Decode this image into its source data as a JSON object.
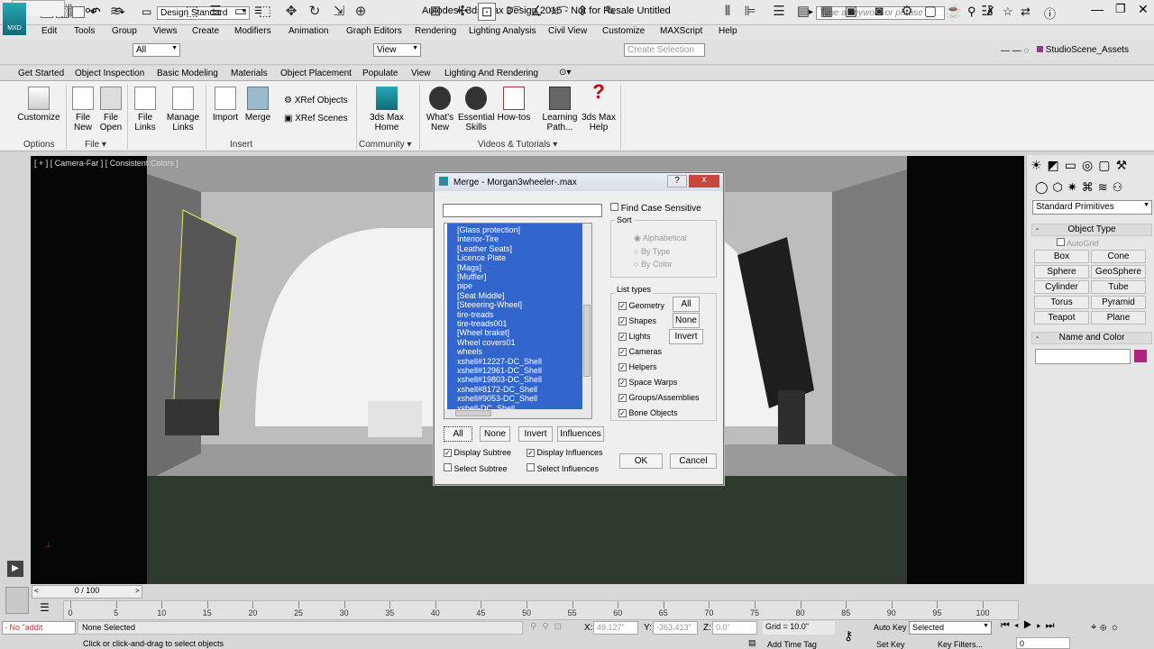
{
  "app": {
    "title": "Autodesk 3ds Max Design 2015  -  Not for Resale    Untitled",
    "logo_text": "MXD",
    "workspace": "Design Standard",
    "search_placeholder": "Type a keyword or phrase"
  },
  "menu": [
    "Edit",
    "Tools",
    "Group",
    "Views",
    "Create",
    "Modifiers",
    "Animation",
    "Graph Editors",
    "Rendering",
    "Lighting Analysis",
    "Civil View",
    "Customize",
    "MAXScript",
    "Help"
  ],
  "toolbar": {
    "filter": "All",
    "view": "View",
    "selection_set": "Create Selection Se",
    "scene": "StudioScene_Assets",
    "snap_labels": [
      "3",
      "%"
    ]
  },
  "ribbon_tabs": [
    "Get Started",
    "Object Inspection",
    "Basic Modeling",
    "Materials",
    "Object Placement",
    "Populate",
    "View",
    "Lighting And Rendering"
  ],
  "ribbon": {
    "customize": "Customize",
    "file_new": [
      "File",
      "New"
    ],
    "file_open": [
      "File",
      "Open"
    ],
    "file_links": [
      "File",
      "Links"
    ],
    "manage_links": [
      "Manage",
      "Links"
    ],
    "import": "Import",
    "merge": "Merge",
    "xref_objects": "XRef Objects",
    "xref_scenes": "XRef Scenes",
    "home": [
      "3ds Max",
      "Home"
    ],
    "whats_new": [
      "What's",
      "New"
    ],
    "essential": [
      "Essential",
      "Skills"
    ],
    "howtos": "How-tos",
    "learning": [
      "Learning",
      "Path..."
    ],
    "help": [
      "3ds Max",
      "Help"
    ],
    "groups": {
      "options": "Options",
      "file": "File",
      "insert": "Insert",
      "community": "Community",
      "videos": "Videos & Tutorials"
    }
  },
  "viewport": {
    "label": "[ + ] [ Camera-Far ] [ Consistent Colors ]"
  },
  "dialog": {
    "title": "Merge - Morgan3wheeler-.max",
    "help": "?",
    "close": "x",
    "items": [
      "[Glass protection]",
      "Interior-Tire",
      "[Leather Seats]",
      "Licence Plate",
      "[Mags]",
      "[Muffler]",
      "pipe",
      "[Seat Middle]",
      "[Steeering-Wheel]",
      "tire-treads",
      "tire-treads001",
      "[Wheel braket]",
      "Wheel covers01",
      "wheels",
      "xshell#12227-DC_Shell",
      "xshell#12961-DC_Shell",
      "xshell#19803-DC_Shell",
      "xshell#8172-DC_Shell",
      "xshell#9053-DC_Shell",
      "xshell-DC_Shell"
    ],
    "find_case": "Find Case Sensitive",
    "sort": "Sort",
    "sort_opts": [
      "Alphabetical",
      "By Type",
      "By Color"
    ],
    "list_types": "List types",
    "types": [
      "Geometry",
      "Shapes",
      "Lights",
      "Cameras",
      "Helpers",
      "Space Warps",
      "Groups/Assemblies",
      "Bone Objects"
    ],
    "type_btns": [
      "All",
      "None",
      "Invert"
    ],
    "btns": [
      "All",
      "None",
      "Invert",
      "Influences"
    ],
    "display_subtree": "Display Subtree",
    "display_influences": "Display Influences",
    "select_subtree": "Select Subtree",
    "select_influences": "Select Influences",
    "ok": "OK",
    "cancel": "Cancel"
  },
  "panel": {
    "category": "Standard Primitives",
    "object_type": "Object Type",
    "autogrid": "AutoGrid",
    "prims": [
      "Box",
      "Cone",
      "Sphere",
      "GeoSphere",
      "Cylinder",
      "Tube",
      "Torus",
      "Pyramid",
      "Teapot",
      "Plane"
    ],
    "name_color": "Name and Color",
    "minus": "-"
  },
  "timeline": {
    "frame": "0 / 100",
    "ticks": [
      "0",
      "5",
      "10",
      "15",
      "20",
      "25",
      "30",
      "35",
      "40",
      "45",
      "50",
      "55",
      "60",
      "65",
      "70",
      "75",
      "80",
      "85",
      "90",
      "95",
      "100"
    ]
  },
  "status": {
    "selected": "None Selected",
    "prompt": "Click or click-and-drag to select objects",
    "maxscript": "- No \"addit",
    "x": "49.127\"",
    "y": "-363.413\"",
    "z": "0.0\"",
    "grid": "Grid = 10.0\"",
    "add_time_tag": "Add Time Tag",
    "autokey": "Auto Key",
    "setkey": "Set Key",
    "selected_dd": "Selected",
    "key_filters": "Key Filters...",
    "frame_field": "0",
    "x_label": "X:",
    "y_label": "Y:",
    "z_label": "Z:"
  }
}
